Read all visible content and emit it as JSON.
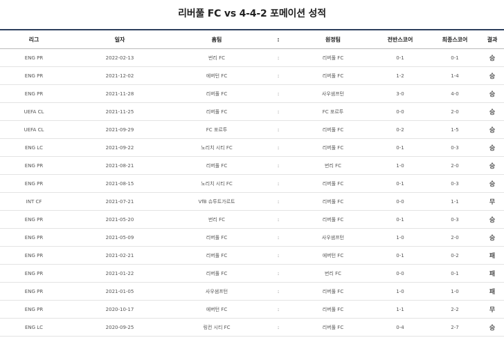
{
  "title": "리버풀 FC vs 4-4-2 포메이션 성적",
  "columns": [
    "리그",
    "일자",
    "홈팀",
    ":",
    "원정팀",
    "전반스코어",
    "최종스코어",
    "결과"
  ],
  "colors": {
    "header_border": "#2b3d5c",
    "win": "#d6001c",
    "loss": "#1f5fd6",
    "draw": "#333333"
  },
  "rows": [
    {
      "league": "ENG PR",
      "date": "2022-02-13",
      "home": "번리 FC",
      "sep": ":",
      "away": "리버풀 FC",
      "half": "0-1",
      "final": "0-1",
      "result": "승"
    },
    {
      "league": "ENG PR",
      "date": "2021-12-02",
      "home": "에버턴 FC",
      "sep": ":",
      "away": "리버풀 FC",
      "half": "1-2",
      "final": "1-4",
      "result": "승"
    },
    {
      "league": "ENG PR",
      "date": "2021-11-28",
      "home": "리버풀 FC",
      "sep": ":",
      "away": "사우샘프턴",
      "half": "3-0",
      "final": "4-0",
      "result": "승"
    },
    {
      "league": "UEFA CL",
      "date": "2021-11-25",
      "home": "리버풀 FC",
      "sep": ":",
      "away": "FC 포르투",
      "half": "0-0",
      "final": "2-0",
      "result": "승"
    },
    {
      "league": "UEFA CL",
      "date": "2021-09-29",
      "home": "FC 포르투",
      "sep": ":",
      "away": "리버풀 FC",
      "half": "0-2",
      "final": "1-5",
      "result": "승"
    },
    {
      "league": "ENG LC",
      "date": "2021-09-22",
      "home": "노리치 시티 FC",
      "sep": ":",
      "away": "리버풀 FC",
      "half": "0-1",
      "final": "0-3",
      "result": "승"
    },
    {
      "league": "ENG PR",
      "date": "2021-08-21",
      "home": "리버풀 FC",
      "sep": ":",
      "away": "번리 FC",
      "half": "1-0",
      "final": "2-0",
      "result": "승"
    },
    {
      "league": "ENG PR",
      "date": "2021-08-15",
      "home": "노리치 시티 FC",
      "sep": ":",
      "away": "리버풀 FC",
      "half": "0-1",
      "final": "0-3",
      "result": "승"
    },
    {
      "league": "INT CF",
      "date": "2021-07-21",
      "home": "VfB 슈투트가르트",
      "sep": ":",
      "away": "리버풀 FC",
      "half": "0-0",
      "final": "1-1",
      "result": "무"
    },
    {
      "league": "ENG PR",
      "date": "2021-05-20",
      "home": "번리 FC",
      "sep": ":",
      "away": "리버풀 FC",
      "half": "0-1",
      "final": "0-3",
      "result": "승"
    },
    {
      "league": "ENG PR",
      "date": "2021-05-09",
      "home": "리버풀 FC",
      "sep": ":",
      "away": "사우샘프턴",
      "half": "1-0",
      "final": "2-0",
      "result": "승"
    },
    {
      "league": "ENG PR",
      "date": "2021-02-21",
      "home": "리버풀 FC",
      "sep": ":",
      "away": "에버턴 FC",
      "half": "0-1",
      "final": "0-2",
      "result": "패"
    },
    {
      "league": "ENG PR",
      "date": "2021-01-22",
      "home": "리버풀 FC",
      "sep": ":",
      "away": "번리 FC",
      "half": "0-0",
      "final": "0-1",
      "result": "패"
    },
    {
      "league": "ENG PR",
      "date": "2021-01-05",
      "home": "사우샘프턴",
      "sep": ":",
      "away": "리버풀 FC",
      "half": "1-0",
      "final": "1-0",
      "result": "패"
    },
    {
      "league": "ENG PR",
      "date": "2020-10-17",
      "home": "에버턴 FC",
      "sep": ":",
      "away": "리버풀 FC",
      "half": "1-1",
      "final": "2-2",
      "result": "무"
    },
    {
      "league": "ENG LC",
      "date": "2020-09-25",
      "home": "링컨 시티 FC",
      "sep": ":",
      "away": "리버풀 FC",
      "half": "0-4",
      "final": "2-7",
      "result": "승"
    }
  ]
}
